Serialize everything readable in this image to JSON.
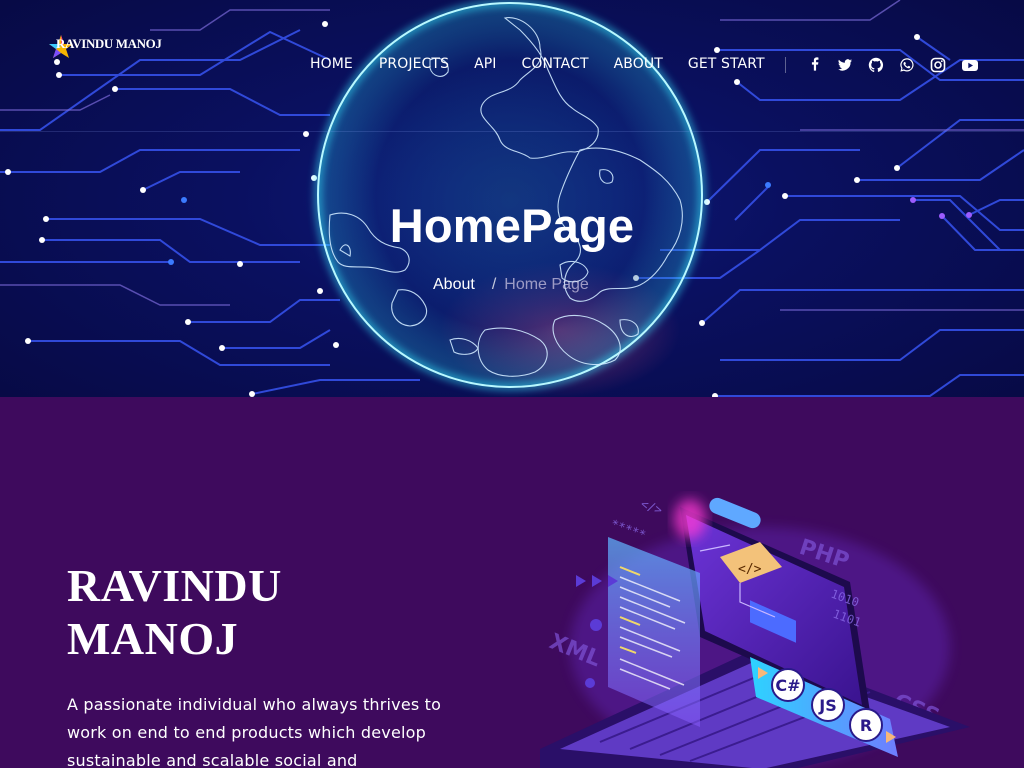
{
  "brand": {
    "name": "RAVINDU MANOJ"
  },
  "nav": {
    "items": [
      {
        "label": "HOME"
      },
      {
        "label": "PROJECTS"
      },
      {
        "label": "API"
      },
      {
        "label": "CONTACT"
      },
      {
        "label": "ABOUT"
      },
      {
        "label": "GET START"
      }
    ]
  },
  "social": [
    {
      "icon": "facebook-icon"
    },
    {
      "icon": "twitter-icon"
    },
    {
      "icon": "github-icon"
    },
    {
      "icon": "whatsapp-icon"
    },
    {
      "icon": "instagram-icon"
    },
    {
      "icon": "youtube-icon"
    }
  ],
  "hero": {
    "title": "HomePage",
    "breadcrumb": {
      "link": "About",
      "separator": "/",
      "current": "Home Page"
    }
  },
  "intro": {
    "name": "RAVINDU MANOJ",
    "description": "A passionate individual who always thrives to work on end to end products which develop sustainable and scalable social and"
  },
  "illustration": {
    "labels": [
      "PHP",
      "XML",
      "CSS",
      "C#",
      "JS",
      "R",
      "</>"
    ]
  },
  "colors": {
    "hero_bg": "#0a1060",
    "main_bg": "#3e0a5d",
    "globe_glow": "#2ee6ff",
    "circuit": "#3b5bff"
  }
}
